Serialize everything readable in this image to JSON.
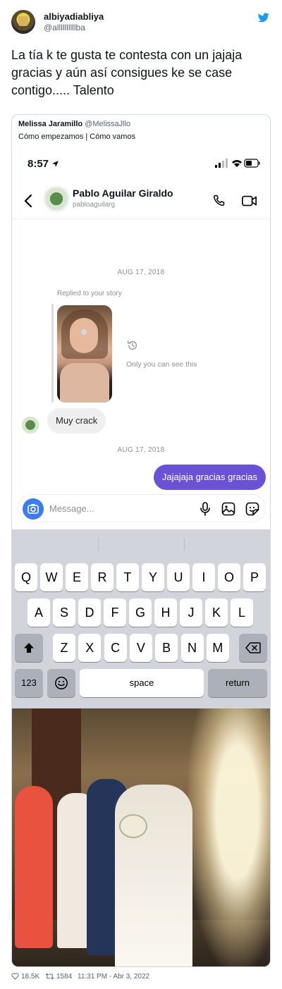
{
  "tweet": {
    "display_name": "albiyadiabliya",
    "handle": "@allllllllllba",
    "text": "La tía k te gusta te contesta con un jajaja gracias y aún así consigues ke se case contigo..... Talento",
    "likes": "18.5K",
    "retweets": "1584",
    "timestamp": "11:31 PM - Abr 3, 2022"
  },
  "quoted": {
    "display_name": "Melissa Jaramillo",
    "handle": "@MelissaJllo",
    "text": "Cómo empezamos | Cómo vamos"
  },
  "phone": {
    "time": "8:57",
    "chat": {
      "name": "Pablo Aguilar Giraldo",
      "username": "pabloaguilarg",
      "date_1": "AUG 17, 2018",
      "replied_label": "Replied to your story",
      "only_you_label": "Only you can see this",
      "incoming_message": "Muy crack",
      "date_2": "AUG 17, 2018",
      "outgoing_message": "Jajajaja gracias gracias",
      "composer_placeholder": "Message..."
    },
    "keyboard": {
      "row1": [
        "Q",
        "W",
        "E",
        "R",
        "T",
        "Y",
        "U",
        "I",
        "O",
        "P"
      ],
      "row2": [
        "A",
        "S",
        "D",
        "F",
        "G",
        "H",
        "J",
        "K",
        "L"
      ],
      "row3": [
        "Z",
        "X",
        "C",
        "V",
        "B",
        "N",
        "M"
      ],
      "numbers_key": "123",
      "space_key": "space",
      "return_key": "return"
    }
  },
  "colors": {
    "twitter_blue": "#1d9bf0",
    "dm_outgoing": "#6a52d8",
    "camera_blue": "#3d7bf0"
  }
}
